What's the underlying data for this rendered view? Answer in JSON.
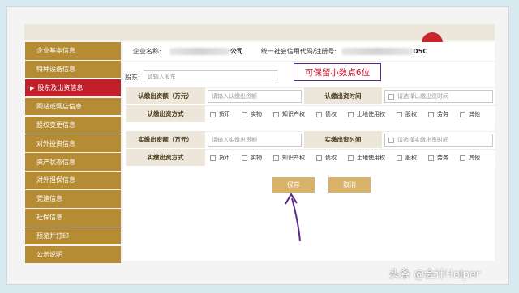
{
  "sidebar": {
    "items": [
      {
        "label": "企业基本信息"
      },
      {
        "label": "特种设备信息"
      },
      {
        "label": "股东及出资信息"
      },
      {
        "label": "网站或网店信息"
      },
      {
        "label": "股权变更信息"
      },
      {
        "label": "对外投资信息"
      },
      {
        "label": "资产状态信息"
      },
      {
        "label": "对外担保信息"
      },
      {
        "label": "党建信息"
      },
      {
        "label": "社保信息"
      },
      {
        "label": "预览并打印"
      },
      {
        "label": "公示说明"
      }
    ],
    "active_index": 2
  },
  "company": {
    "name_label": "企业名称:",
    "name_suffix": "公司",
    "code_label": "统一社会信用代码/注册号:",
    "code_suffix": "D5C"
  },
  "shareholder": {
    "label": "股东:",
    "placeholder": "请输入股东"
  },
  "callout": "可保留小数点6位",
  "subscribed": {
    "amount_label": "认缴出资额（万元）",
    "amount_placeholder": "请输入认缴出资额",
    "time_label": "认缴出资时间",
    "time_placeholder": "请选择认缴出资时间",
    "method_label": "认缴出资方式"
  },
  "paid": {
    "amount_label": "实缴出资额（万元）",
    "amount_placeholder": "请输入实缴出资额",
    "time_label": "实缴出资时间",
    "time_placeholder": "请选择实缴出资时间",
    "method_label": "实缴出资方式"
  },
  "methods": [
    "货币",
    "实物",
    "知识产权",
    "债权",
    "土地使用权",
    "股权",
    "劳务",
    "其他"
  ],
  "buttons": {
    "save": "保存",
    "cancel": "取消"
  },
  "watermark": "头条 @会计Helper",
  "colors": {
    "sidebar": "#b58c34",
    "sidebar_active": "#c0202a",
    "button": "#d9b26a",
    "callout_text": "#d0102a",
    "annotation": "#5a2a8a"
  }
}
